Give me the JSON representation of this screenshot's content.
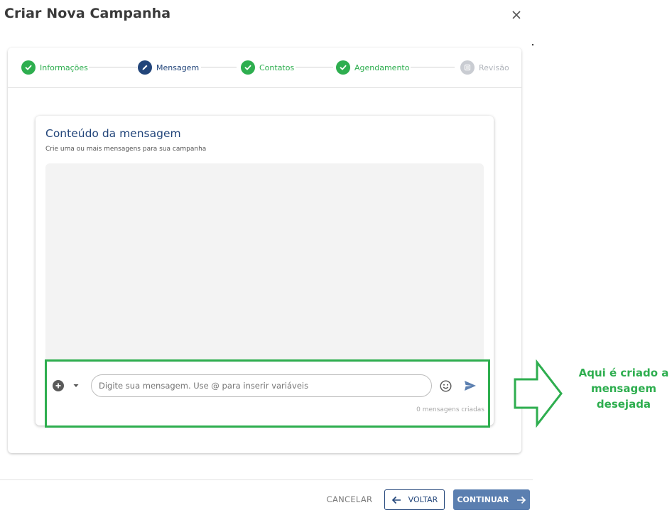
{
  "dialog": {
    "title": "Criar Nova Campanha",
    "close_icon": "close-icon"
  },
  "stepper": {
    "steps": [
      {
        "label": "Informações",
        "state": "done",
        "icon": "check-icon"
      },
      {
        "label": "Mensagem",
        "state": "active",
        "icon": "pencil-icon"
      },
      {
        "label": "Contatos",
        "state": "done",
        "icon": "check-icon"
      },
      {
        "label": "Agendamento",
        "state": "done",
        "icon": "check-icon"
      },
      {
        "label": "Revisão",
        "state": "pending",
        "icon": "list-icon"
      }
    ]
  },
  "message_panel": {
    "title": "Conteúdo da mensagem",
    "subtitle": "Crie uma ou mais mensagens para sua campanha",
    "input_placeholder": "Digite sua mensagem. Use @ para inserir variáveis",
    "input_value": "",
    "counter": "0 mensagens criadas"
  },
  "annotation": {
    "text": "Aqui é criado a mensagem desejada",
    "color": "#2eae4f"
  },
  "footer": {
    "cancel_label": "CANCELAR",
    "back_label": "VOLTAR",
    "continue_label": "CONTINUAR"
  },
  "colors": {
    "primary": "#22457a",
    "success": "#2eae4f",
    "continue_button": "#5b7fb0",
    "pending": "#c9ccd2"
  }
}
